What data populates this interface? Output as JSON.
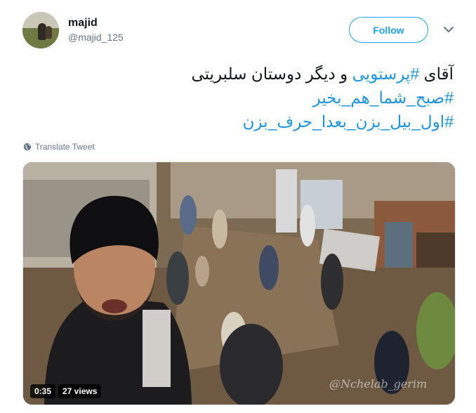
{
  "author": {
    "display_name": "majid",
    "handle": "@majid_125"
  },
  "follow_button_label": "Follow",
  "tweet": {
    "line1_hashtag": "#پرستویی",
    "line1_start": "آقای",
    "line1_rest": "و دیگر دوستان سلبریتی",
    "line2_hashtag": "#صبح_شما_هم_بخیر",
    "line3_hashtag": "#اول_بیل_بزن_بعدا_حرف_بزن"
  },
  "translate_label": "Translate Tweet",
  "video": {
    "duration": "0:35",
    "views": "27 views",
    "watermark": "@Nchelab_gerim"
  },
  "colors": {
    "accent": "#1da1f2",
    "hashtag": "#1b95e0",
    "secondary_text": "#657786"
  },
  "icons": {
    "caret": "chevron-down-icon",
    "translate": "globe-icon"
  }
}
